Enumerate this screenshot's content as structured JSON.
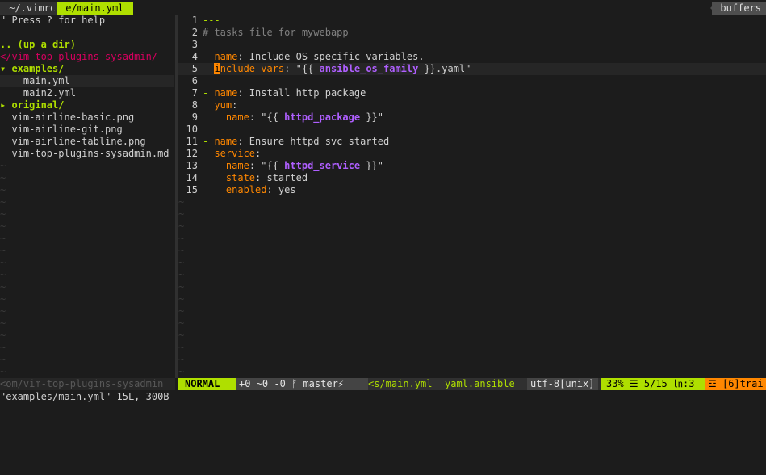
{
  "tabline": {
    "tabs": [
      {
        "label": " ~/.vimrc"
      },
      {
        "label": " e/main.yml"
      }
    ],
    "buffers_label": "buffers"
  },
  "tree": {
    "help": "\" Press ? for help",
    "updir": ".. (up a dir)",
    "root": "</vim-top-plugins-sysadmin/",
    "items": [
      {
        "label": "▾ examples/",
        "kind": "dir"
      },
      {
        "label": "    main.yml",
        "kind": "file"
      },
      {
        "label": "    main2.yml",
        "kind": "file"
      },
      {
        "label": "▸ original/",
        "kind": "dir"
      },
      {
        "label": "  vim-airline-basic.png",
        "kind": "file"
      },
      {
        "label": "  vim-airline-git.png",
        "kind": "file"
      },
      {
        "label": "  vim-airline-tabline.png",
        "kind": "file"
      },
      {
        "label": "  vim-top-plugins-sysadmin.md",
        "kind": "file"
      }
    ],
    "tilde": "~"
  },
  "editor": {
    "lines": [
      {
        "n": "1",
        "parts": [
          {
            "c": "c-doc",
            "t": "---"
          }
        ]
      },
      {
        "n": "2",
        "parts": [
          {
            "c": "c-comment",
            "t": "# tasks file for mywebapp"
          }
        ]
      },
      {
        "n": "3",
        "parts": []
      },
      {
        "n": "4",
        "parts": [
          {
            "c": "c-fold",
            "t": "- "
          },
          {
            "c": "c-key",
            "t": "name"
          },
          {
            "c": "c-str",
            "t": ": Include OS-specific variables."
          }
        ]
      },
      {
        "n": "5",
        "parts": [
          {
            "c": "",
            "t": "  "
          },
          {
            "c": "cursor",
            "t": "i"
          },
          {
            "c": "c-key",
            "t": "nclude_vars"
          },
          {
            "c": "c-str",
            "t": ": \"{{ "
          },
          {
            "c": "c-var",
            "t": "ansible_os_family"
          },
          {
            "c": "c-str",
            "t": " }}.yaml\""
          }
        ]
      },
      {
        "n": "6",
        "parts": []
      },
      {
        "n": "7",
        "parts": [
          {
            "c": "c-fold",
            "t": "- "
          },
          {
            "c": "c-key",
            "t": "name"
          },
          {
            "c": "c-str",
            "t": ": Install http package"
          }
        ]
      },
      {
        "n": "8",
        "parts": [
          {
            "c": "",
            "t": "  "
          },
          {
            "c": "c-key",
            "t": "yum"
          },
          {
            "c": "c-str",
            "t": ":"
          }
        ]
      },
      {
        "n": "9",
        "parts": [
          {
            "c": "",
            "t": "    "
          },
          {
            "c": "c-key",
            "t": "name"
          },
          {
            "c": "c-str",
            "t": ": \"{{ "
          },
          {
            "c": "c-var",
            "t": "httpd_package"
          },
          {
            "c": "c-str",
            "t": " }}\""
          }
        ]
      },
      {
        "n": "10",
        "parts": []
      },
      {
        "n": "11",
        "parts": [
          {
            "c": "c-fold",
            "t": "- "
          },
          {
            "c": "c-key",
            "t": "name"
          },
          {
            "c": "c-str",
            "t": ": Ensure httpd svc started"
          }
        ]
      },
      {
        "n": "12",
        "parts": [
          {
            "c": "",
            "t": "  "
          },
          {
            "c": "c-key",
            "t": "service"
          },
          {
            "c": "c-str",
            "t": ":"
          }
        ]
      },
      {
        "n": "13",
        "parts": [
          {
            "c": "",
            "t": "    "
          },
          {
            "c": "c-key",
            "t": "name"
          },
          {
            "c": "c-str",
            "t": ": \"{{ "
          },
          {
            "c": "c-var",
            "t": "httpd_service"
          },
          {
            "c": "c-str",
            "t": " }}\""
          }
        ]
      },
      {
        "n": "14",
        "parts": [
          {
            "c": "",
            "t": "    "
          },
          {
            "c": "c-key",
            "t": "state"
          },
          {
            "c": "c-str",
            "t": ": started"
          }
        ]
      },
      {
        "n": "15",
        "parts": [
          {
            "c": "",
            "t": "    "
          },
          {
            "c": "c-key",
            "t": "enabled"
          },
          {
            "c": "c-str",
            "t": ": yes"
          }
        ]
      }
    ],
    "current_line": "5"
  },
  "statusline": {
    "left": "<om/vim-top-plugins-sysadmin",
    "mode": "NORMAL",
    "git": "+0 ~0 -0 ᚠ master⚡",
    "file": "<s/main.yml",
    "filetype": "yaml.ansible",
    "encoding": "utf-8[unix]",
    "position": "33% ☰ 5/15 ㏑:3",
    "warnings": "☲ [6]trai"
  },
  "cmdline": "\"examples/main.yml\" 15L, 300B",
  "colors": {
    "accent": "#afdf00",
    "background": "#1c1c1c",
    "key": "#ff8700",
    "variable": "#af5fff",
    "root_dir": "#d7005f"
  }
}
